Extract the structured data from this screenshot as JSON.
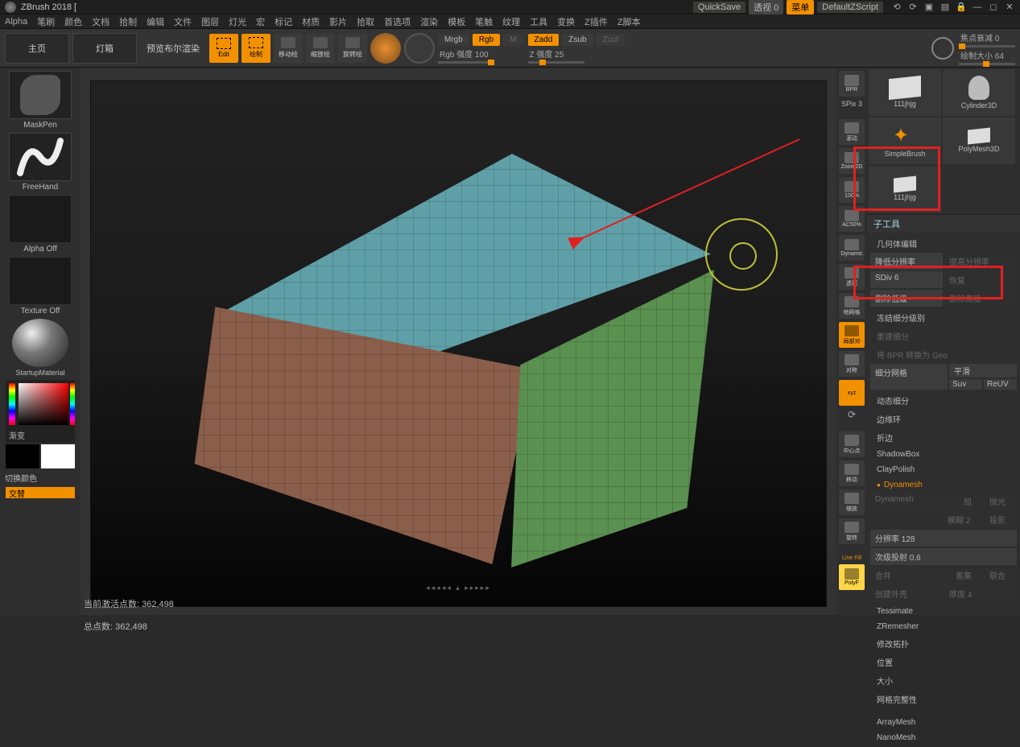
{
  "app": {
    "title": "ZBrush 2018 ["
  },
  "titlebar": {
    "quicksave": "QuickSave",
    "persp": "透视  0",
    "menu": "菜单",
    "script": "DefaultZScript"
  },
  "menus": [
    "Alpha",
    "笔刷",
    "颜色",
    "文档",
    "拾制",
    "编辑",
    "文件",
    "图层",
    "灯光",
    "宏",
    "标记",
    "材质",
    "影片",
    "拾取",
    "首选项",
    "渲染",
    "模板",
    "笔触",
    "纹理",
    "工具",
    "变换",
    "Z插件",
    "Z脚本"
  ],
  "toolbar": {
    "home": "主页",
    "lightbox": "灯箱",
    "preview": "预览布尔渲染",
    "edit": "Edit",
    "draw": "绘制",
    "move": "移动绘",
    "scale": "缩放绘",
    "rotate": "旋转绘",
    "mrgb": "Mrgb",
    "rgb": "Rgb",
    "m": "M",
    "zadd": "Zadd",
    "zsub": "Zsub",
    "zcut": "Zcut",
    "rgb_intensity_label": "Rgb 强度 100",
    "z_intensity_label": "Z 强度 25",
    "focal_label": "焦点衰减 0",
    "drawsize_label": "绘制大小 64"
  },
  "left": {
    "maskpen": "MaskPen",
    "freehand": "FreeHand",
    "alpha_off": "Alpha Off",
    "texture_off": "Texture Off",
    "material": "StartupMaterial",
    "gradient": "渐变",
    "switch_color": "切换颜色",
    "alternate": "交替"
  },
  "midvert": {
    "bpr": "BPR",
    "spix": "SPix 3",
    "scroll": "滚动",
    "zoom2d": "Zoom2D",
    "pct100": "100%",
    "ac50": "AC50%",
    "dynamic": "Dynamic",
    "persp": "透视",
    "floor": "地网格",
    "localsym": "局部对",
    "sym": "对称",
    "xyz": "xyz",
    "center": "中心点",
    "move": "移动",
    "zoom": "缩放",
    "rotate": "旋转",
    "linefill": "Line Fill",
    "polyf": "PolyF"
  },
  "right": {
    "thumbs": {
      "t1": "111jhjg",
      "t2": "Cylinder3D",
      "t3": "SimpleBrush",
      "t4": "111jhjg",
      "t5": "PolyMesh3D"
    },
    "subtool": "子工具",
    "geom_header": "几何体编辑",
    "lower_res": "降低分辨率",
    "higher_res": "提高分辨率",
    "sdiv": "SDiv 6",
    "restore": "恢复",
    "del_lower": "删除低级",
    "del_higher": "删除高级",
    "freeze_sub": "冻结细分级别",
    "rebuild": "重建细分",
    "bpr_geo": "将 BPR 转换为 Geo",
    "divide": "细分网格",
    "smooth": "平滑",
    "suv": "Suv",
    "reuv": "ReUV",
    "dyn_sub": "动态细分",
    "edgeloop": "边缘环",
    "crease": "折边",
    "shadowbox": "ShadowBox",
    "claypolish": "ClayPolish",
    "dynamesh_h": "Dynamesh",
    "dynamesh": "Dynamesh",
    "group": "组",
    "polish": "抛光",
    "blur": "模糊 2",
    "project": "投影",
    "resolution": "分辨率 128",
    "subproj": "次级投射 0.6",
    "merge": "合并",
    "diff": "差集",
    "union": "联合",
    "shell": "创建外壳",
    "thickness": "厚度 4",
    "tessimate": "Tessimate",
    "zremesher": "ZRemesher",
    "modify_topo": "修改拓扑",
    "position": "位置",
    "size": "大小",
    "mesh_integrity": "网格完整性",
    "arraymesh": "ArrayMesh",
    "nanomesh": "NanoMesh"
  },
  "status": {
    "active": "当前激活点数: 362,498",
    "total": "总点数: 362,498"
  }
}
